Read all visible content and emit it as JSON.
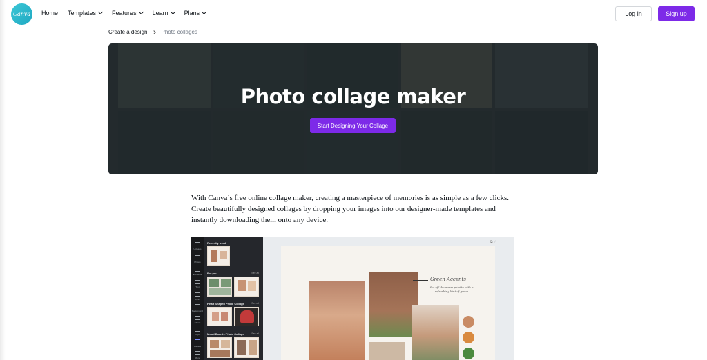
{
  "header": {
    "logo_text": "Canva",
    "nav": [
      {
        "label": "Home",
        "has_menu": false
      },
      {
        "label": "Templates",
        "has_menu": true
      },
      {
        "label": "Features",
        "has_menu": true
      },
      {
        "label": "Learn",
        "has_menu": true
      },
      {
        "label": "Plans",
        "has_menu": true
      }
    ],
    "login_label": "Log in",
    "signup_label": "Sign up"
  },
  "breadcrumb": {
    "parent": "Create a design",
    "current": "Photo collages"
  },
  "hero": {
    "title": "Photo collage maker",
    "cta_label": "Start Designing Your Collage"
  },
  "intro": {
    "text": "With Canva’s free online collage maker, creating a masterpiece of memories is as simple as a few clicks. Create beautifully designed collages by dropping your images into our designer-made templates and instantly downloading them onto any device."
  },
  "preview": {
    "rail_items": [
      "Uploads",
      "Photos",
      "Elements",
      "Text",
      "Styles",
      "Background",
      "Charts",
      "Logos",
      "Folders",
      "More"
    ],
    "panel_sections": [
      {
        "title": "Recently used",
        "see_all": ""
      },
      {
        "title": "For you",
        "see_all": "See all"
      },
      {
        "title": "Heart Shaped Photo Collage",
        "see_all": "See all"
      },
      {
        "title": "Mood Boards Photo Collage",
        "see_all": "See all"
      }
    ],
    "canvas": {
      "accent_title": "Green Accents",
      "accent_desc": "Set off the warm palette with a refreshing hint of green",
      "swatches": [
        "#c98b64",
        "#d98a3f",
        "#4b8a3e"
      ]
    }
  },
  "colors": {
    "brand_purple": "#7d2ae8",
    "logo_teal": "#20c4cb"
  }
}
